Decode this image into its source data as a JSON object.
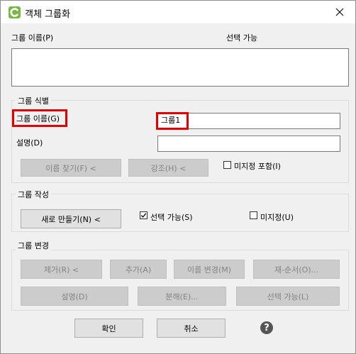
{
  "window": {
    "title": "객체 그룹화"
  },
  "top": {
    "group_name_label": "그룹 이름(P)",
    "selectable_label": "선택 가능"
  },
  "identify": {
    "title": "그룹 식별",
    "name_label": "그룹 이름(G)",
    "name_value": "그룹1",
    "desc_label": "설명(D)",
    "desc_value": "",
    "find_button": "이름 찾기(F) <",
    "highlight_button": "강조(H) <",
    "include_unnamed_label": "미지정 포함(I)"
  },
  "create": {
    "title": "그룹 작성",
    "new_button": "새로 만들기(N) <",
    "selectable_label": "선택 가능(S)",
    "selectable_checked": true,
    "unnamed_label": "미지정(U)",
    "unnamed_checked": false
  },
  "modify": {
    "title": "그룹 변경",
    "remove_button": "제거(R) <",
    "add_button": "추가(A)",
    "rename_button": "이름 변경(M)",
    "reorder_button": "재-순서(O)...",
    "description_button": "설명(D)",
    "explode_button": "분해(E)...",
    "selectable_button": "선택 가능(L)"
  },
  "footer": {
    "ok_button": "확인",
    "cancel_button": "취소"
  },
  "colors": {
    "highlight": "#e50000",
    "app_icon": "#7ab648"
  }
}
